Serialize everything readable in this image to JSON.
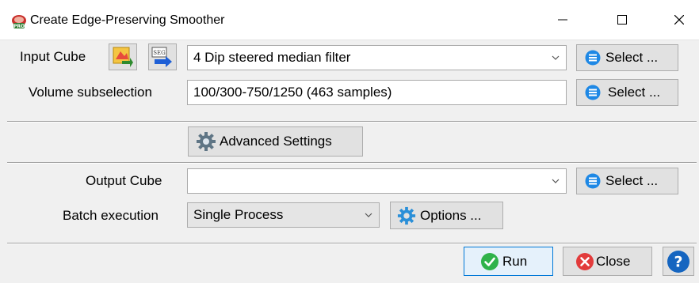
{
  "window": {
    "title": "Create Edge-Preserving Smoother",
    "controls": [
      "minimize-icon",
      "maximize-icon",
      "close-icon"
    ]
  },
  "input_cube": {
    "label": "Input Cube",
    "value": "4 Dip steered median filter",
    "select_label": "Select ...",
    "seg_icon_text": "SEG"
  },
  "volume_subselection": {
    "label": "Volume subselection",
    "value": "100/300-750/1250 (463 samples)",
    "select_label": "Select ..."
  },
  "advanced_settings": {
    "label": "Advanced Settings"
  },
  "output_cube": {
    "label": "Output Cube",
    "value": "",
    "select_label": "Select ..."
  },
  "batch_execution": {
    "label": "Batch execution",
    "value": "Single Process",
    "options_label": "Options ..."
  },
  "footer": {
    "run_label": "Run",
    "close_label": "Close",
    "help_text": "?"
  },
  "colors": {
    "run_green": "#2fb24a",
    "close_red": "#e23b3b",
    "select_blue": "#1e88e5",
    "help_blue": "#1565c0",
    "focus_border": "#0078d7"
  }
}
